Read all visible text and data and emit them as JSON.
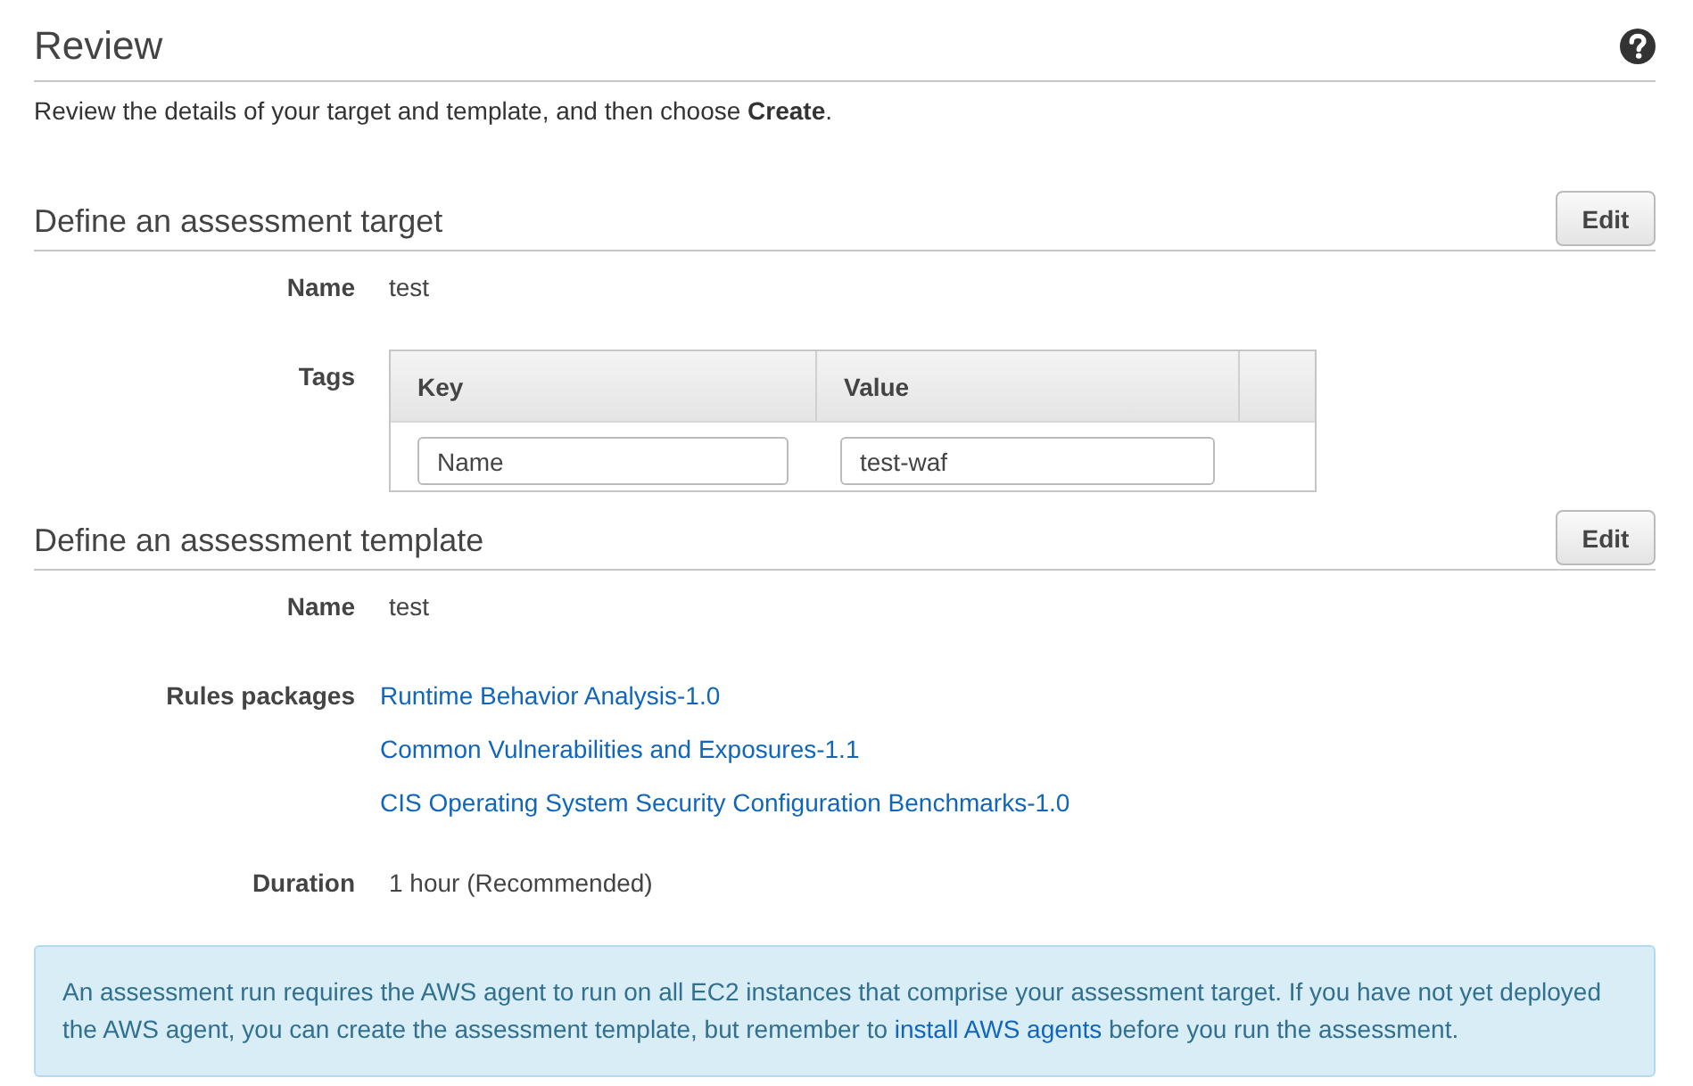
{
  "page": {
    "title": "Review",
    "intro": "Review the details of your target and template, and then choose **Create**."
  },
  "sections": [
    {
      "title": "Define an assessment target",
      "edit_button": "Edit",
      "fields": [
        {
          "kind": "text",
          "label": "Name",
          "value": "test"
        },
        {
          "kind": "tags",
          "label": "Tags",
          "columns": [
            "Key",
            "Value"
          ],
          "rows": [
            {
              "key": "Name",
              "value": "test-waf"
            }
          ]
        }
      ]
    },
    {
      "title": "Define an assessment template",
      "edit_button": "Edit",
      "fields": [
        {
          "kind": "text",
          "label": "Name",
          "value": "test"
        },
        {
          "kind": "links",
          "label": "Rules packages",
          "links": [
            "Runtime Behavior Analysis-1.0",
            "Common Vulnerabilities and Exposures-1.1",
            "CIS Operating System Security Configuration Benchmarks-1.0"
          ]
        },
        {
          "kind": "text",
          "label": "Duration",
          "value": "1 hour (Recommended)"
        }
      ]
    }
  ],
  "info_box": {
    "text": "An assessment run requires the AWS agent to run on all EC2 instances that comprise your assessment target. If you have not yet deployed the AWS agent, you can create the assessment template, but remember to",
    "link": "install AWS agents",
    "text_after": "before you run the assessment."
  }
}
